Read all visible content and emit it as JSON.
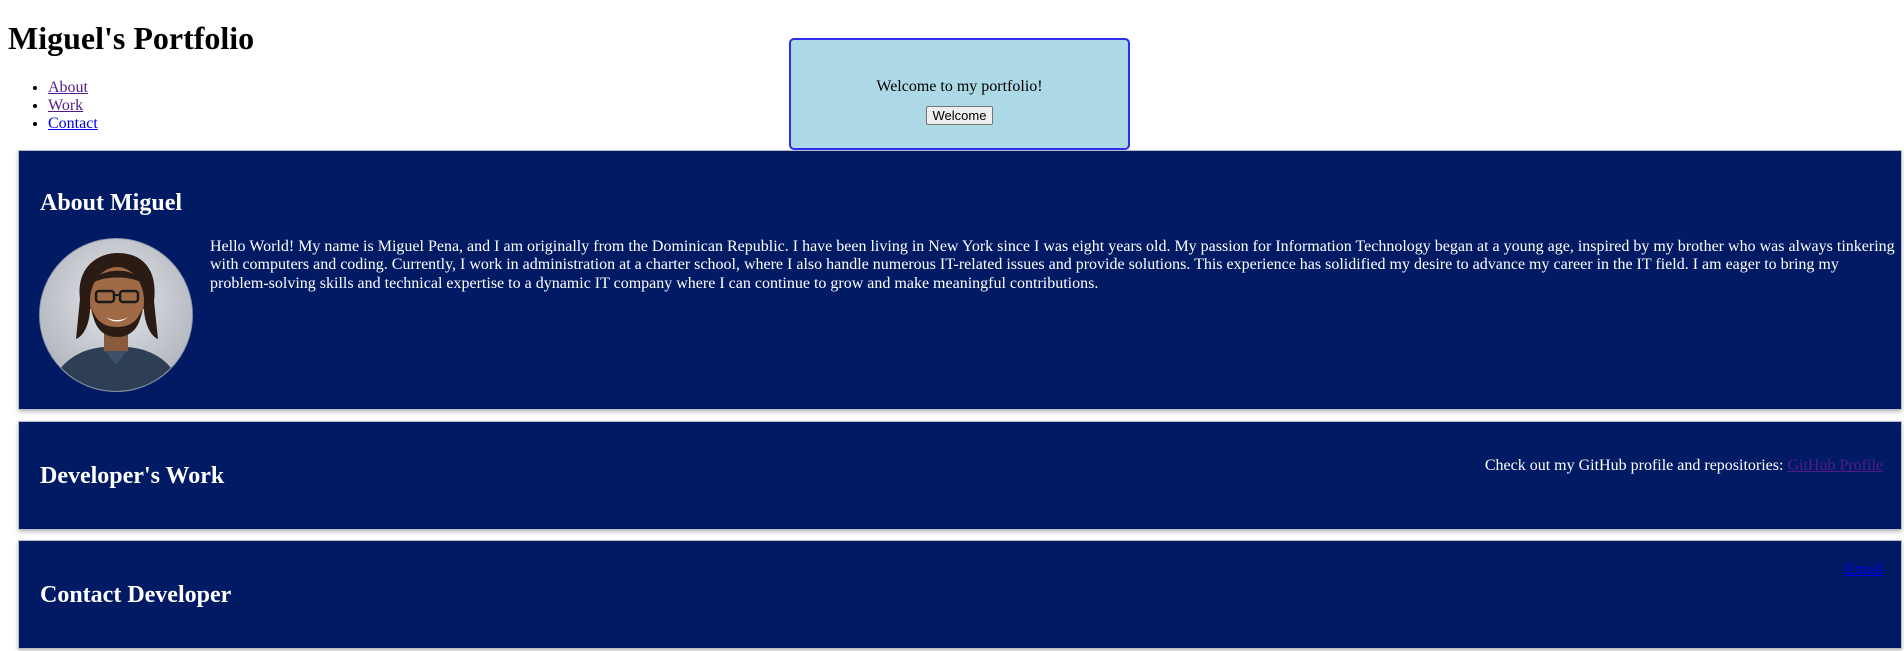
{
  "header": {
    "title": "Miguel's Portfolio"
  },
  "nav": {
    "items": [
      {
        "label": "About",
        "icon": "bullet-icon"
      },
      {
        "label": "Work",
        "icon": "bullet-icon"
      },
      {
        "label": "Contact",
        "icon": "bullet-icon"
      }
    ]
  },
  "welcome": {
    "message": "Welcome to my portfolio!",
    "button_label": "Welcome"
  },
  "about": {
    "heading": "About Miguel",
    "bio": "Hello World! My name is Miguel Pena, and I am originally from the Dominican Republic. I have been living in New York since I was eight years old. My passion for Information Technology began at a young age, inspired by my brother who was always tinkering with computers and coding. Currently, I work in administration at a charter school, where I also handle numerous IT-related issues and provide solutions. This experience has solidified my desire to advance my career in the IT field. I am eager to bring my problem-solving skills and technical expertise to a dynamic IT company where I can continue to grow and make meaningful contributions."
  },
  "work": {
    "heading": "Developer's Work",
    "text": "Check out my GitHub profile and repositories: ",
    "link_label": "GitHub Profile"
  },
  "contact": {
    "heading": "Contact Developer",
    "email_label": "Email"
  },
  "colors": {
    "section_background": "#001a63",
    "welcome_background": "#add8e6",
    "welcome_border": "#2d2df0",
    "visited_link": "#551a8b",
    "unvisited_link": "#0000ee"
  }
}
